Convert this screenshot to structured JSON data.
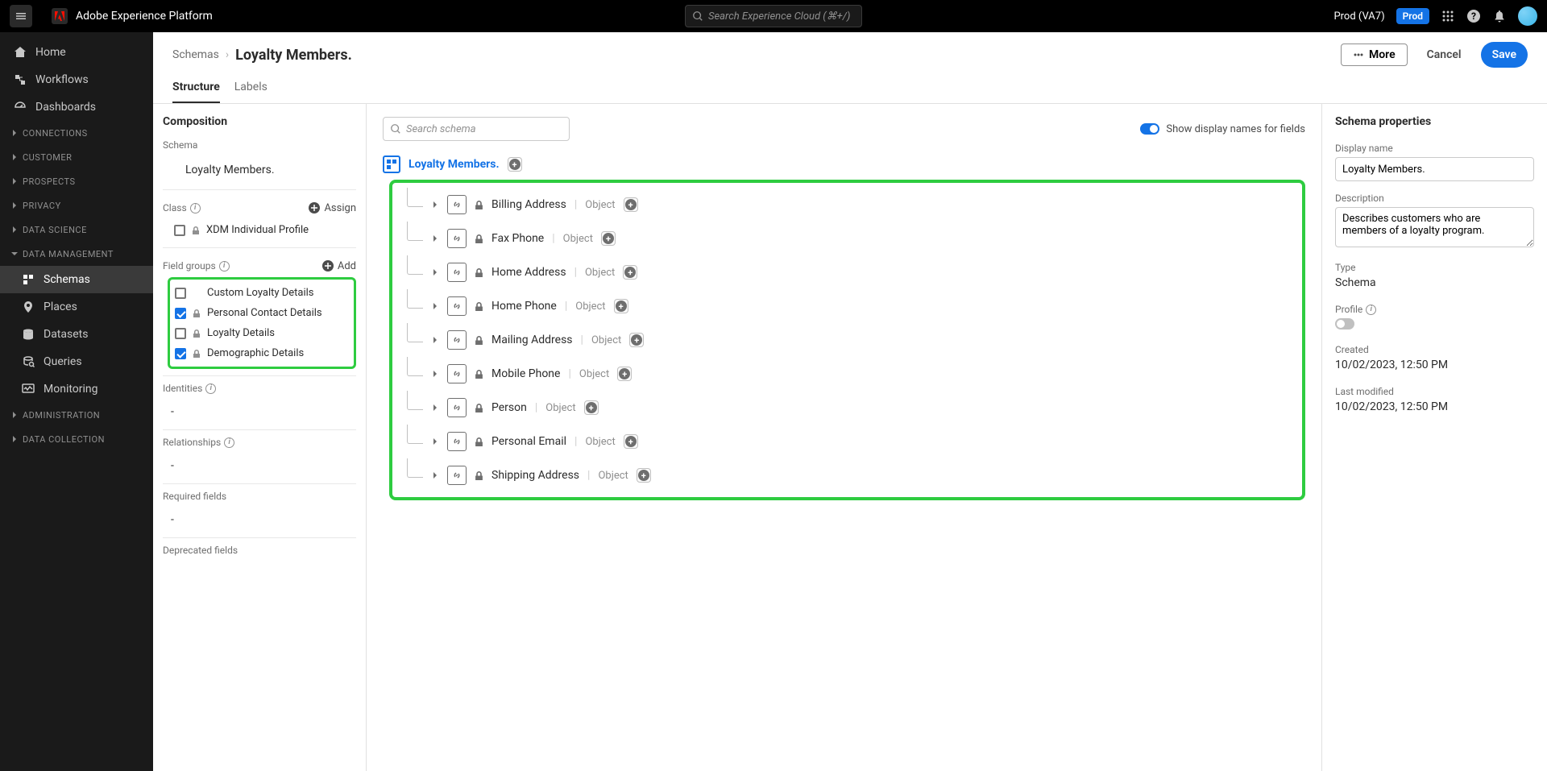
{
  "topbar": {
    "app_title": "Adobe Experience Platform",
    "search_placeholder": "Search Experience Cloud (⌘+/)",
    "env_label": "Prod (VA7)",
    "prod_badge": "Prod"
  },
  "nav": {
    "home": "Home",
    "workflows": "Workflows",
    "dashboards": "Dashboards",
    "connections": "CONNECTIONS",
    "customer": "CUSTOMER",
    "prospects": "PROSPECTS",
    "privacy": "PRIVACY",
    "data_science": "DATA SCIENCE",
    "data_management": "DATA MANAGEMENT",
    "schemas": "Schemas",
    "places": "Places",
    "datasets": "Datasets",
    "queries": "Queries",
    "monitoring": "Monitoring",
    "administration": "ADMINISTRATION",
    "data_collection": "DATA COLLECTION"
  },
  "header": {
    "crumb_parent": "Schemas",
    "crumb_current": "Loyalty Members.",
    "more": "More",
    "cancel": "Cancel",
    "save": "Save",
    "tab_structure": "Structure",
    "tab_labels": "Labels"
  },
  "composition": {
    "title": "Composition",
    "schema_label": "Schema",
    "schema_name": "Loyalty Members.",
    "class_label": "Class",
    "assign": "Assign",
    "class_name": "XDM Individual Profile",
    "field_groups_label": "Field groups",
    "add": "Add",
    "field_groups": [
      {
        "name": "Custom Loyalty Details",
        "checked": false,
        "locked": false
      },
      {
        "name": "Personal Contact Details",
        "checked": true,
        "locked": true
      },
      {
        "name": "Loyalty Details",
        "checked": false,
        "locked": true
      },
      {
        "name": "Demographic Details",
        "checked": true,
        "locked": true
      }
    ],
    "identities_label": "Identities",
    "relationships_label": "Relationships",
    "required_label": "Required fields",
    "deprecated_label": "Deprecated fields",
    "dash": "-"
  },
  "canvas": {
    "search_placeholder": "Search schema",
    "toggle_label": "Show display names for fields",
    "root_name": "Loyalty Members.",
    "fields": [
      {
        "name": "Billing Address",
        "type": "Object"
      },
      {
        "name": "Fax Phone",
        "type": "Object"
      },
      {
        "name": "Home Address",
        "type": "Object"
      },
      {
        "name": "Home Phone",
        "type": "Object"
      },
      {
        "name": "Mailing Address",
        "type": "Object"
      },
      {
        "name": "Mobile Phone",
        "type": "Object"
      },
      {
        "name": "Person",
        "type": "Object"
      },
      {
        "name": "Personal Email",
        "type": "Object"
      },
      {
        "name": "Shipping Address",
        "type": "Object"
      }
    ]
  },
  "props": {
    "title": "Schema properties",
    "display_name_label": "Display name",
    "display_name": "Loyalty Members.",
    "description_label": "Description",
    "description": "Describes customers who are members of a loyalty program.",
    "type_label": "Type",
    "type": "Schema",
    "profile_label": "Profile",
    "created_label": "Created",
    "created": "10/02/2023, 12:50 PM",
    "modified_label": "Last modified",
    "modified": "10/02/2023, 12:50 PM"
  }
}
